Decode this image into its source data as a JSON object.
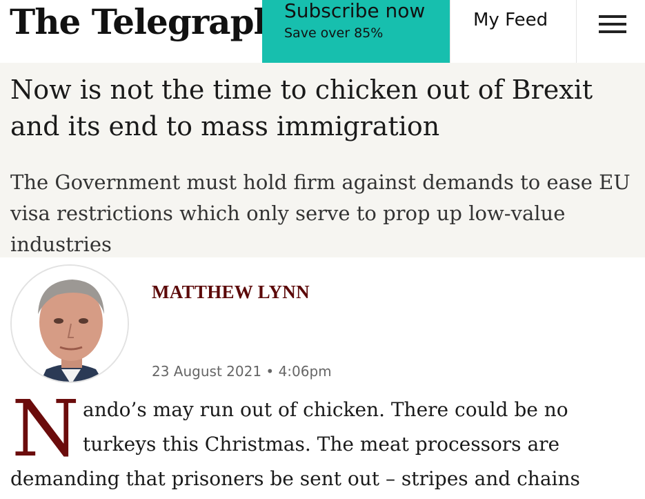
{
  "header": {
    "logo": "The Telegraph",
    "subscribe_title": "Subscribe now",
    "subscribe_sub": "Save over 85%",
    "my_feed": "My Feed"
  },
  "article": {
    "headline": "Now is not the time to chicken out of Brexit and its end to mass immigration",
    "standfirst": "The Government must hold firm against demands to ease EU visa restrictions which only serve to prop up low-value industries",
    "author": "MATTHEW LYNN",
    "date": "23 August 2021 • 4:06pm",
    "body": {
      "dropcap": "N",
      "line1": "ando’s may run out of chicken. There could be no",
      "line2": "turkeys this Christmas. The meat processors are",
      "line3": "demanding that prisoners be sent out – stripes and chains"
    }
  },
  "colors": {
    "subscribe_bg": "#17bfae",
    "headline_band": "#f6f5f1",
    "author": "#5c0a0a",
    "dropcap": "#6b0c0c"
  },
  "icons": {
    "menu": "hamburger-menu-icon"
  }
}
